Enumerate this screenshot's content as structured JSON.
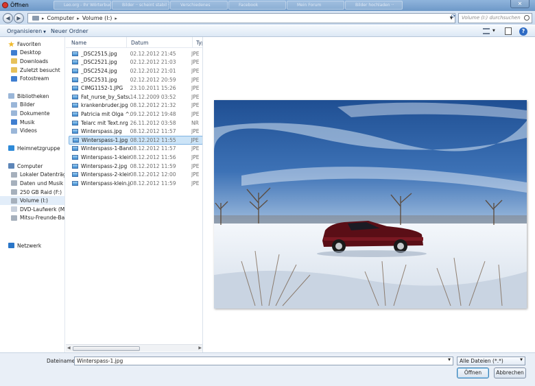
{
  "window": {
    "title": "Öffnen",
    "background_tabs": [
      "Leo.org - Ihr Wörterbuch im Internet",
      "Bilder ·· scheint stabil ··",
      "Verschiedenes",
      "Facebook",
      "Mein Forum",
      "Bilder hochladen ··"
    ]
  },
  "navigation": {
    "breadcrumb": [
      "Computer",
      "Volume (I:)"
    ],
    "search_placeholder": "Volume (I:) durchsuchen"
  },
  "toolbar": {
    "organize_label": "Organisieren",
    "new_folder_label": "Neuer Ordner"
  },
  "sidebar": {
    "favorites": {
      "label": "Favoriten",
      "items": [
        "Desktop",
        "Downloads",
        "Zuletzt besucht",
        "Fotostream"
      ]
    },
    "libraries": {
      "label": "Bibliotheken",
      "items": [
        "Bilder",
        "Dokumente",
        "Musik",
        "Videos"
      ]
    },
    "homegroup": {
      "label": "Heimnetzgruppe"
    },
    "computer": {
      "label": "Computer",
      "items": [
        "Lokaler Datenträger",
        "Daten und Musik  PC",
        "250 GB Raid (F:)",
        "Volume (I:)",
        "DVD-Laufwerk (M:) A",
        "Mitsu-Freunde-BaWü"
      ],
      "selected_index": 3
    },
    "network": {
      "label": "Netzwerk"
    }
  },
  "file_list": {
    "columns": [
      "Name",
      "Datum",
      "Typ"
    ],
    "rows": [
      {
        "name": "_DSC2515.jpg",
        "date": "02.12.2012 21:45",
        "type": "JPE"
      },
      {
        "name": "_DSC2521.jpg",
        "date": "02.12.2012 21:03",
        "type": "JPE"
      },
      {
        "name": "_DSC2524.jpg",
        "date": "02.12.2012 21:01",
        "type": "JPE"
      },
      {
        "name": "_DSC2531.jpg",
        "date": "02.12.2012 20:59",
        "type": "JPE"
      },
      {
        "name": "CIMG1152-1.JPG",
        "date": "23.10.2011 15:26",
        "type": "JPE"
      },
      {
        "name": "Fat_nurse_by_Satsur...",
        "date": "14.12.2009 03:52",
        "type": "JPE"
      },
      {
        "name": "krankenbruder.jpg",
        "date": "08.12.2012 21:32",
        "type": "JPE"
      },
      {
        "name": "Patricia mit Olga ^...",
        "date": "09.12.2012 19:48",
        "type": "JPE"
      },
      {
        "name": "Telarc mit Text.nrg",
        "date": "26.11.2012 03:58",
        "type": "NR"
      },
      {
        "name": "Winterspass.jpg",
        "date": "08.12.2012 11:57",
        "type": "JPE"
      },
      {
        "name": "Winterspass-1.jpg",
        "date": "08.12.2012 11:55",
        "type": "JPE"
      },
      {
        "name": "Winterspass-1-Bann...",
        "date": "08.12.2012 11:57",
        "type": "JPE"
      },
      {
        "name": "Winterspass-1-klein...",
        "date": "08.12.2012 11:56",
        "type": "JPE"
      },
      {
        "name": "Winterspass-2.jpg",
        "date": "08.12.2012 11:59",
        "type": "JPE"
      },
      {
        "name": "Winterspass-2-klein...",
        "date": "08.12.2012 12:00",
        "type": "JPE"
      },
      {
        "name": "Winterspass-klein.jpg",
        "date": "08.12.2012 11:59",
        "type": "JPE"
      }
    ],
    "selected_index": 10
  },
  "footer": {
    "filename_label": "Dateiname:",
    "filename_value": "Winterspass-1.jpg",
    "filter_value": "Alle Dateien (*.*)",
    "open_label": "Öffnen",
    "cancel_label": "Abbrechen"
  },
  "colors": {
    "frame": "#c9daee",
    "selection": "#cce4f7",
    "selection_border": "#7fb3e3",
    "sky": "#3a6aa8",
    "car": "#5a0e16"
  }
}
